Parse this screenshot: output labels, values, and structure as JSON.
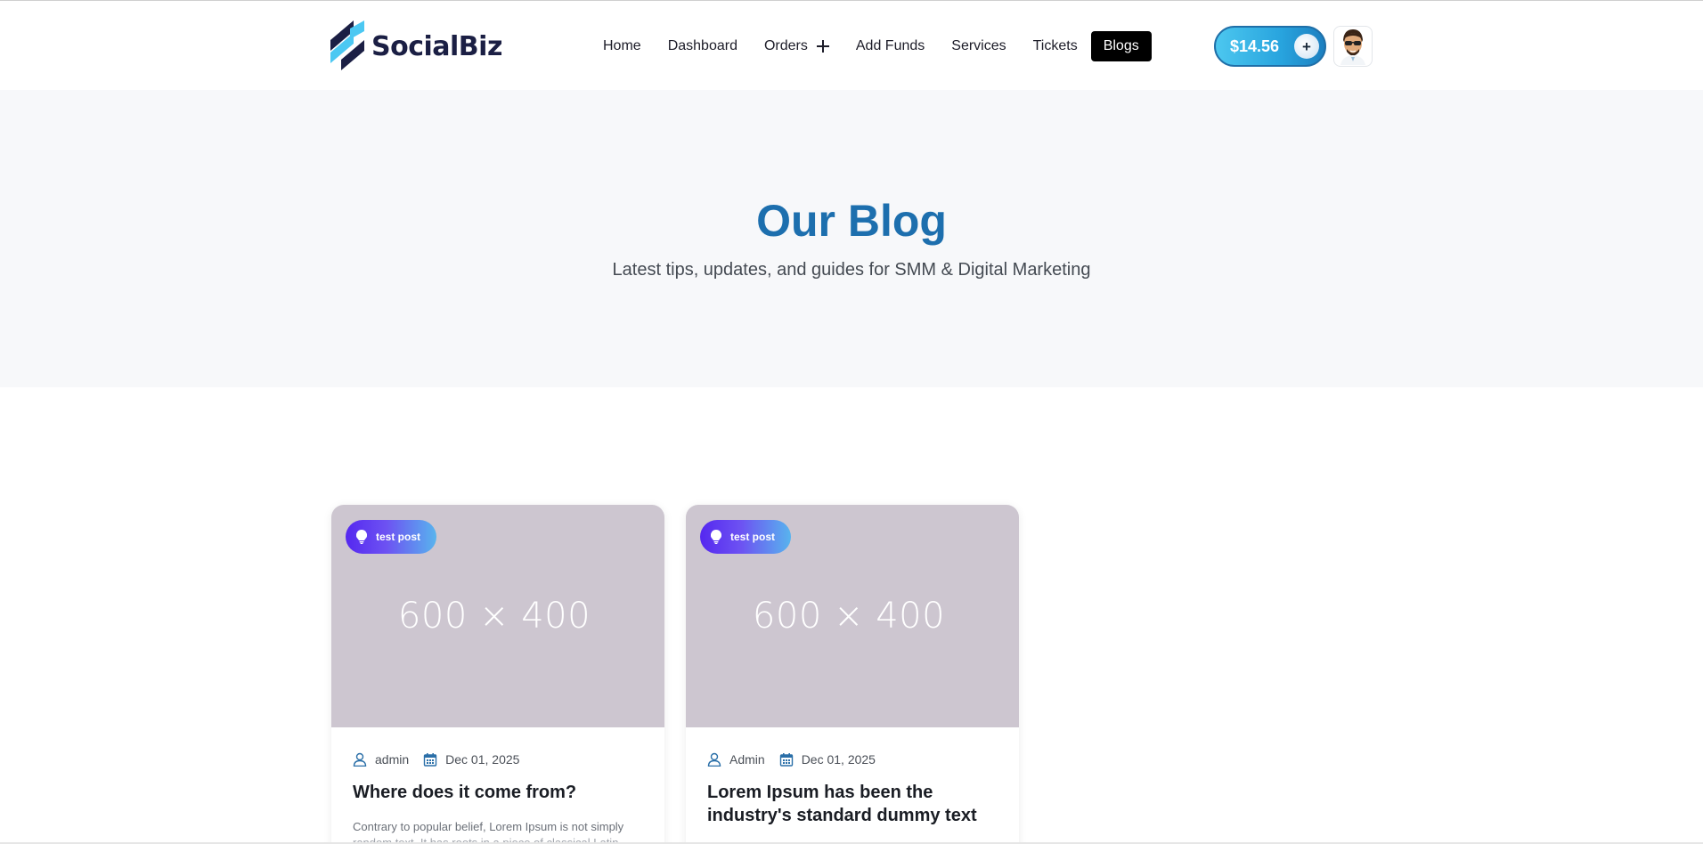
{
  "header": {
    "logo_text": "SocialBiz",
    "nav": [
      {
        "label": "Home"
      },
      {
        "label": "Dashboard"
      },
      {
        "label": "Orders"
      },
      {
        "label": "Add Funds"
      },
      {
        "label": "Services"
      },
      {
        "label": "Tickets"
      },
      {
        "label": "Blogs"
      }
    ],
    "balance": "$14.56",
    "balance_plus": "+"
  },
  "hero": {
    "title": "Our Blog",
    "subtitle": "Latest tips, updates, and guides for SMM & Digital Marketing"
  },
  "posts": [
    {
      "tag": "test post",
      "image_placeholder": "600 × 400",
      "author": "admin",
      "date": "Dec 01, 2025",
      "title": "Where does it come from?",
      "excerpt_line1": "Contrary to popular belief, Lorem Ipsum is not simply",
      "excerpt_line2": "random text. It has roots in a piece of classical Latin"
    },
    {
      "tag": "test post",
      "image_placeholder": "600 × 400",
      "author": "Admin",
      "date": "Dec 01, 2025",
      "title": "Lorem Ipsum has been the industry's standard dummy text"
    }
  ],
  "colors": {
    "accent": "#1d6fae",
    "nav_active_bg": "#000000",
    "balance_gradient_start": "#4cc7ef",
    "balance_gradient_end": "#1c7fc0",
    "tag_gradient_start": "#5528f0",
    "tag_gradient_end": "#58b4ee",
    "hero_bg": "#f7f8fa",
    "image_placeholder_bg": "#cdc6d0"
  },
  "icons": {
    "logo": "stripes-logo-icon",
    "orders_expand": "plus-icon",
    "avatar": "avatar-icon",
    "tag": "lightbulb-icon",
    "author": "user-icon",
    "date": "calendar-icon"
  }
}
